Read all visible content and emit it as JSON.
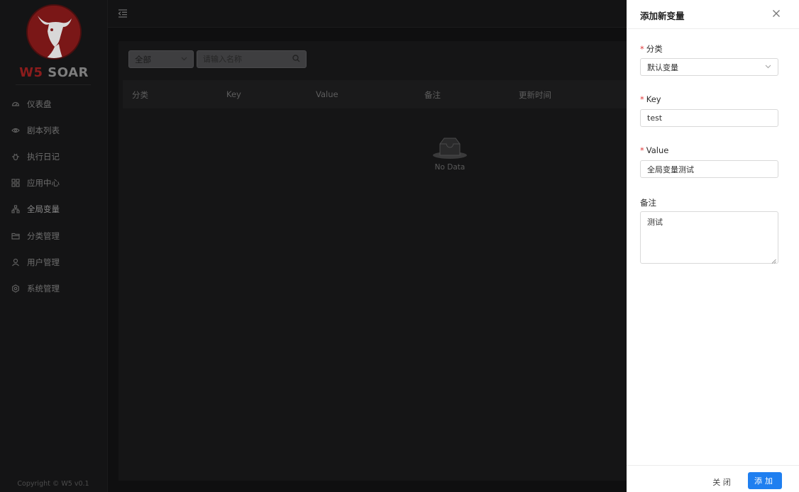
{
  "brand": {
    "logo_w5": "W5",
    "logo_soar": "SOAR",
    "copyright": "Copyright © W5 v0.1"
  },
  "sidebar": {
    "items": [
      {
        "label": "仪表盘",
        "icon": "dashboard-icon"
      },
      {
        "label": "剧本列表",
        "icon": "playbook-icon"
      },
      {
        "label": "执行日记",
        "icon": "bug-icon"
      },
      {
        "label": "应用中心",
        "icon": "apps-icon"
      },
      {
        "label": "全局变量",
        "icon": "cluster-icon"
      },
      {
        "label": "分类管理",
        "icon": "folder-icon"
      },
      {
        "label": "用户管理",
        "icon": "user-icon"
      },
      {
        "label": "系统管理",
        "icon": "settings-icon"
      }
    ],
    "active_index": 4
  },
  "toolbar": {
    "category_select": "全部",
    "search_placeholder": "请输入名称"
  },
  "table": {
    "columns": [
      "分类",
      "Key",
      "Value",
      "备注",
      "更新时间"
    ],
    "empty_text": "No Data"
  },
  "drawer": {
    "title": "添加新变量",
    "fields": {
      "category": {
        "label": "分类",
        "required": true,
        "value": "默认变量"
      },
      "key": {
        "label": "Key",
        "required": true,
        "value": "test"
      },
      "value": {
        "label": "Value",
        "required": true,
        "value": "全局变量测试"
      },
      "remark": {
        "label": "备注",
        "required": false,
        "value": "测试"
      }
    },
    "close_label": "关 闭",
    "add_label": "添加"
  },
  "colors": {
    "primary": "#1f7ff0",
    "required": "#e03b3b",
    "brand_red": "#8a1c1c"
  }
}
